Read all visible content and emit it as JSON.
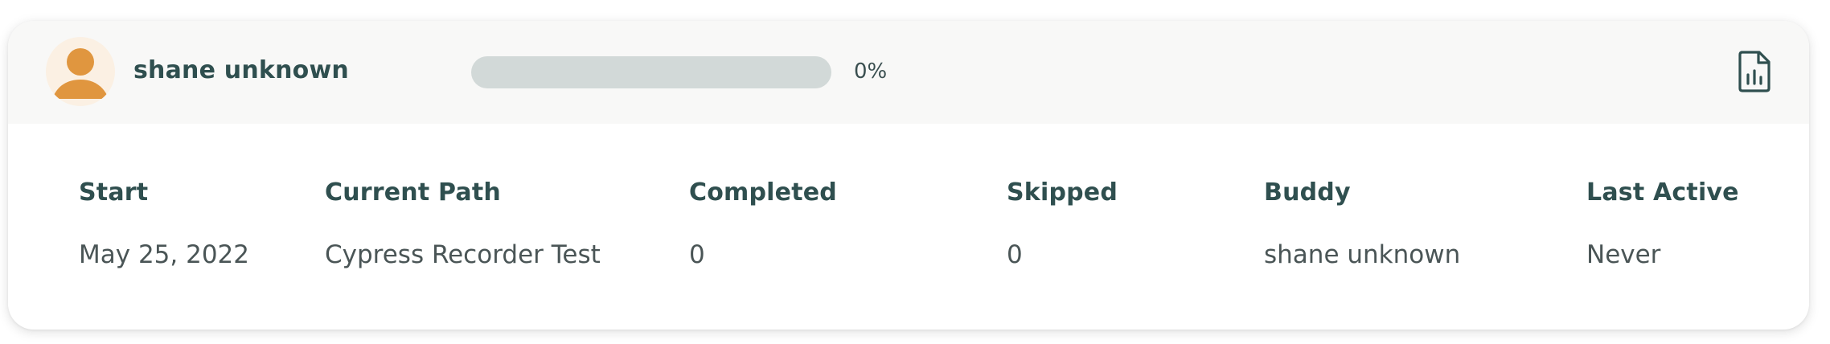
{
  "user": {
    "name": "shane unknown",
    "avatar_icon": "person-icon"
  },
  "progress": {
    "percent": 0,
    "label": "0%"
  },
  "actions": {
    "report_icon": "report-document-icon"
  },
  "details": {
    "columns": [
      {
        "header": "Start",
        "value": "May 25, 2022"
      },
      {
        "header": "Current Path",
        "value": "Cypress Recorder Test"
      },
      {
        "header": "Completed",
        "value": "0"
      },
      {
        "header": "Skipped",
        "value": "0"
      },
      {
        "header": "Buddy",
        "value": "shane unknown"
      },
      {
        "header": "Last Active",
        "value": "Never"
      }
    ]
  },
  "colors": {
    "header_background": "#f8f8f7",
    "text_primary": "#2f4f4f",
    "avatar_accent": "#e0963f",
    "progress_track": "#d2d9d8"
  }
}
